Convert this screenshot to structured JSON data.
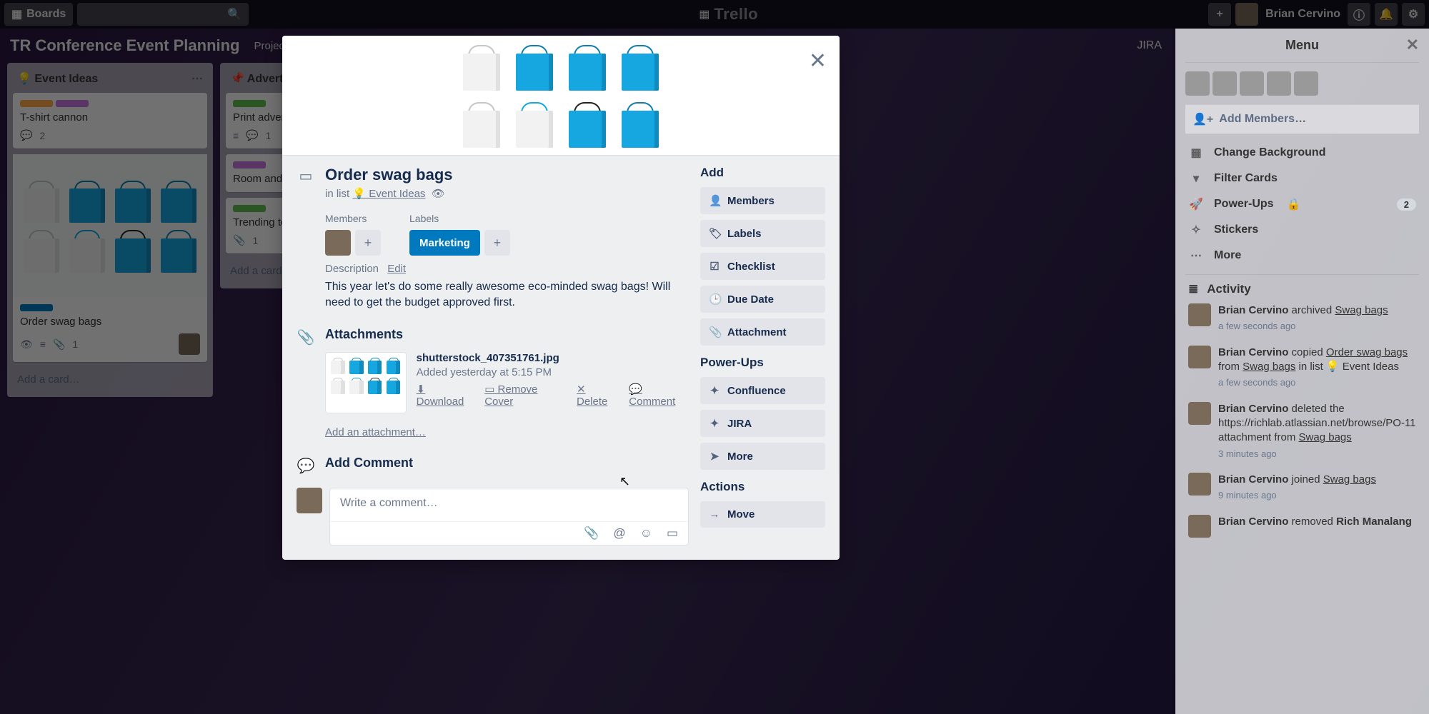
{
  "topbar": {
    "boards": "Boards",
    "user": "Brian Cervino"
  },
  "board": {
    "title": "TR Conference Event Planning",
    "header_items": [
      "Project G",
      "JIRA"
    ]
  },
  "lists": [
    {
      "title": "💡 Event Ideas",
      "add": "Add a card…",
      "cards": [
        {
          "title": "T-shirt cannon",
          "labels": [
            "orange",
            "purple"
          ],
          "comments": "2"
        },
        {
          "title": "Order swag bags",
          "labels": [
            "blue"
          ],
          "attachments": "1",
          "watch": true,
          "desc": true,
          "member": true,
          "cover": true
        }
      ]
    },
    {
      "title": "📌 Advertis",
      "add": "Add a card…",
      "cards": [
        {
          "title": "Print adver",
          "labels": [
            "green"
          ],
          "comments": "1",
          "desc": true
        },
        {
          "title": "Room and",
          "labels": [
            "purple"
          ]
        },
        {
          "title": "Trending to",
          "labels": [
            "green"
          ],
          "attachments": "1"
        }
      ]
    }
  ],
  "menu": {
    "title": "Menu",
    "add_members": "Add Members…",
    "items": {
      "background": "Change Background",
      "filter": "Filter Cards",
      "powerups": "Power-Ups",
      "powerups_badge": "2",
      "stickers": "Stickers",
      "more": "More"
    },
    "activity_label": "Activity",
    "activity": [
      {
        "actor": "Brian Cervino",
        "text_before": " archived ",
        "link": "Swag bags",
        "text_after": "",
        "time": "a few seconds ago"
      },
      {
        "actor": "Brian Cervino",
        "text_before": " copied ",
        "link": "Order swag bags",
        "text_after": " from Swag bags in list 💡 Event Ideas",
        "time": "a few seconds ago"
      },
      {
        "actor": "Brian Cervino",
        "text_before": " deleted the https://richlab.atlassian.net/browse/PO-11 attachment from ",
        "link": "Swag bags",
        "text_after": "",
        "time": "3 minutes ago"
      },
      {
        "actor": "Brian Cervino",
        "text_before": " joined ",
        "link": "Swag bags",
        "text_after": "",
        "time": "9 minutes ago"
      },
      {
        "actor": "Brian Cervino",
        "text_before": " removed ",
        "link": "",
        "text_after": "Rich Manalang",
        "time": ""
      }
    ]
  },
  "modal": {
    "title": "Order swag bags",
    "in_list_prefix": "in list ",
    "in_list": "💡 Event Ideas",
    "members_label": "Members",
    "labels_label": "Labels",
    "label": {
      "text": "Marketing",
      "color": "#0079bf"
    },
    "description_label": "Description",
    "description_edit": "Edit",
    "description_text": "This year let's do some really awesome eco-minded swag bags! Will need to get the budget approved first.",
    "attachments_label": "Attachments",
    "attachment": {
      "name": "shutterstock_407351761.jpg",
      "added": "Added yesterday at 5:15 PM",
      "download": "Download",
      "remove_cover": "Remove Cover",
      "delete": "Delete",
      "comment": "Comment"
    },
    "add_attachment": "Add an attachment…",
    "add_comment_label": "Add Comment",
    "comment_placeholder": "Write a comment…",
    "side": {
      "add": "Add",
      "members": "Members",
      "labels": "Labels",
      "checklist": "Checklist",
      "due_date": "Due Date",
      "attachment": "Attachment",
      "powerups": "Power-Ups",
      "confluence": "Confluence",
      "jira": "JIRA",
      "more": "More",
      "actions": "Actions",
      "move": "Move"
    }
  }
}
